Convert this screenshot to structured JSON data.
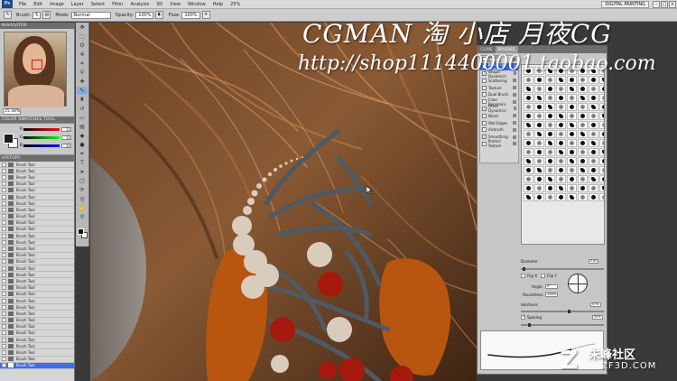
{
  "app": {
    "logo": "Ps",
    "menus": [
      "File",
      "Edit",
      "Image",
      "Layer",
      "Select",
      "Filter",
      "Analysis",
      "3D",
      "View",
      "Window",
      "Help"
    ],
    "zoom_readout": "25%",
    "workspace": "DIGITAL PAINTING",
    "window_buttons": [
      "–",
      "□",
      "×"
    ]
  },
  "options": {
    "tool_label": "Brush:",
    "brush_size": "5",
    "mode_label": "Mode:",
    "mode_value": "Normal",
    "opacity_label": "Opacity:",
    "opacity_value": "100%",
    "flow_label": "Flow:",
    "flow_value": "100%"
  },
  "navigator": {
    "title": "NAVIGATOR",
    "zoom": "25.38%"
  },
  "color_panel": {
    "title": "COLOR   SWATCHES   TOOL PRESETS",
    "r_label": "R",
    "r_value": "11",
    "g_label": "G",
    "g_value": "11",
    "b_label": "B",
    "b_value": "11"
  },
  "history": {
    "title": "HISTORY",
    "item_label": "Brush Tool",
    "row_count": 32
  },
  "brush_panel": {
    "tabs": [
      "CLONE",
      "BRUSHES"
    ],
    "items": [
      {
        "label": "Brush Presets",
        "checked": false
      },
      {
        "label": "Brush Tip Shape",
        "checked": false,
        "selected": true
      },
      {
        "label": "Shape Dynamics",
        "checked": true
      },
      {
        "label": "Scattering",
        "checked": false
      },
      {
        "label": "Texture",
        "checked": false
      },
      {
        "label": "Dual Brush",
        "checked": false
      },
      {
        "label": "Color Dynamics",
        "checked": false
      },
      {
        "label": "Other Dynamics",
        "checked": true
      },
      {
        "label": "Noise",
        "checked": false
      },
      {
        "label": "Wet Edges",
        "checked": false
      },
      {
        "label": "Airbrush",
        "checked": false
      },
      {
        "label": "Smoothing",
        "checked": true
      },
      {
        "label": "Protect Texture",
        "checked": false
      }
    ],
    "diameter_label": "Diameter",
    "diameter_value": "5 px",
    "flip_x": "Flip X",
    "flip_y": "Flip Y",
    "angle_label": "Angle:",
    "angle_value": "0°",
    "roundness_label": "Roundness:",
    "roundness_value": "100%",
    "hardness_label": "Hardness",
    "hardness_value": "57%",
    "spacing_label": "Spacing",
    "spacing_value": "10%"
  },
  "watermark": {
    "title": "CGMAN 淘 小店    月夜CG",
    "url": "http://shop1114400001.taobao.com",
    "brand": "朱峰社区",
    "site": "ZF3D.COM",
    "logo": "Z"
  },
  "colors": {
    "hair_dark": "#4a2a16",
    "hair_light": "#b07446",
    "orange": "#b8560f",
    "red_dot": "#a51a0c",
    "cream_dot": "#d9ccbd",
    "slate_stroke": "#4e5a63",
    "selection_blue": "#3a6ee8"
  }
}
